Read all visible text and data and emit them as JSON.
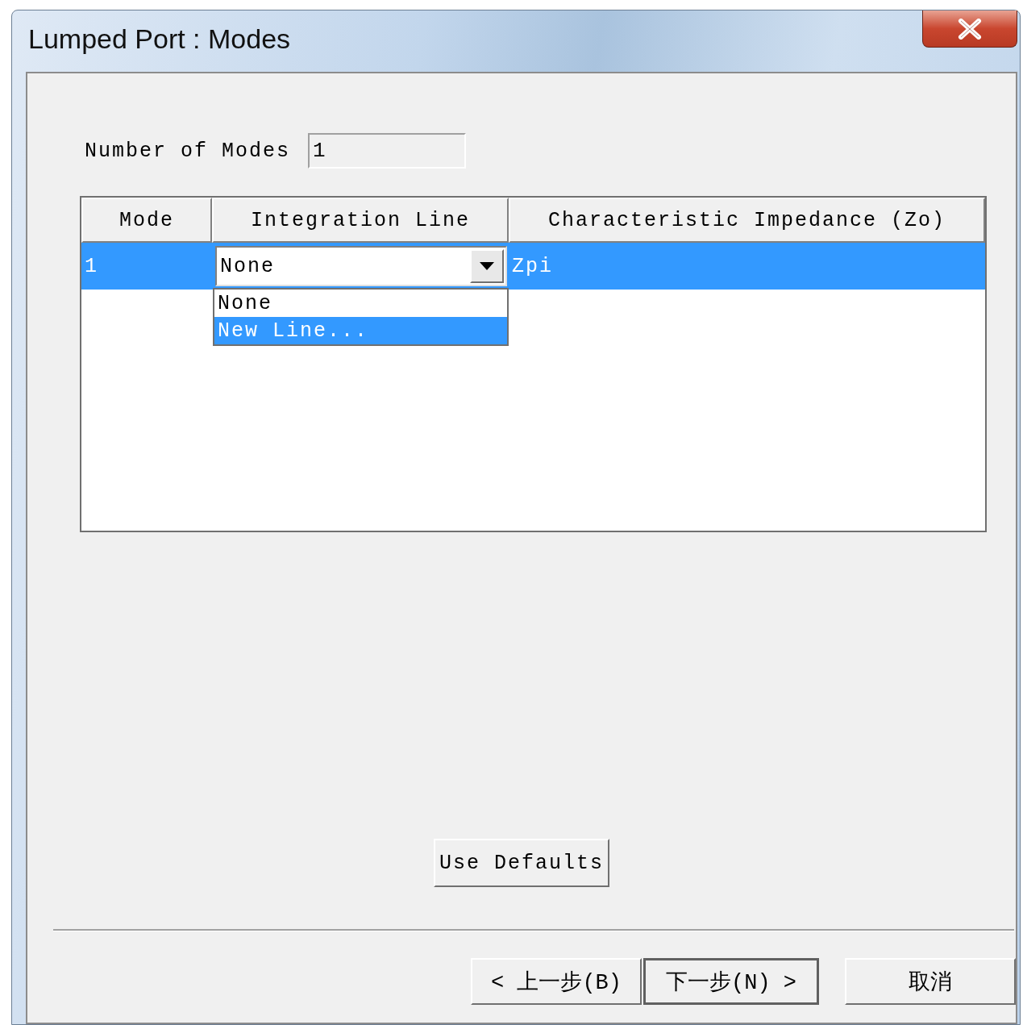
{
  "window": {
    "title": "Lumped Port : Modes"
  },
  "number_of_modes": {
    "label": "Number of Modes",
    "value": "1"
  },
  "table": {
    "columns": [
      "Mode",
      "Integration Line",
      "Characteristic Impedance (Zo)"
    ],
    "rows": [
      {
        "mode": "1",
        "integration_line": "None",
        "impedance": "Zpi",
        "selected": true
      }
    ]
  },
  "dropdown": {
    "expanded": true,
    "options": [
      {
        "label": "None",
        "selected": false
      },
      {
        "label": "New Line...",
        "selected": true
      }
    ]
  },
  "use_defaults_button": {
    "label": "Use Defaults"
  },
  "footer_buttons": [
    {
      "label": "< 上一步(B)",
      "default": false
    },
    {
      "label": "下一步(N) >",
      "default": true
    },
    {
      "label": "取消",
      "default": false
    }
  ]
}
